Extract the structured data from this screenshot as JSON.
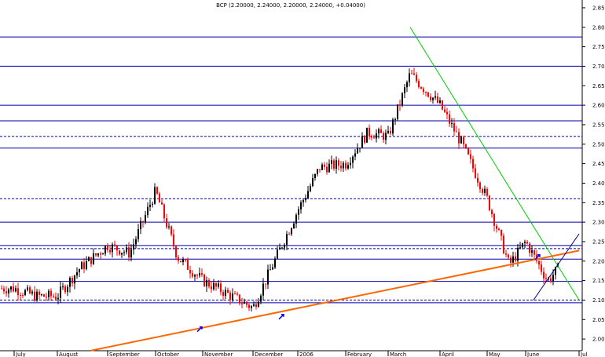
{
  "chart_data": {
    "type": "candlestick",
    "title": "BCP (2.20000, 2.24000, 2.20000, 2.24000, +0.04000)",
    "x_tick_labels": [
      "July",
      "August",
      "September",
      "October",
      "November",
      "December",
      "2006",
      "February",
      "March",
      "April",
      "May",
      "June",
      "Jul"
    ],
    "y_tick_labels": [
      "2.00",
      "2.05",
      "2.10",
      "2.15",
      "2.20",
      "2.25",
      "2.30",
      "2.35",
      "2.40",
      "2.45",
      "2.50",
      "2.55",
      "2.60",
      "2.65",
      "2.70",
      "2.75",
      "2.80",
      "2.85"
    ],
    "ylim": [
      1.97,
      2.87
    ],
    "ytick_step": 0.05,
    "grid": false,
    "colors": {
      "up_candle": "#000000",
      "down_candle": "#ff0000",
      "support_resistance": "#0000aa",
      "downtrend_line": "#00cc00",
      "uptrend_line": "#ff6600",
      "channel_line": "#000080",
      "arrow_marker": "#0000ff"
    },
    "horizontal_levels": [
      {
        "value": 2.775,
        "style": "solid"
      },
      {
        "value": 2.7,
        "style": "solid"
      },
      {
        "value": 2.6,
        "style": "solid"
      },
      {
        "value": 2.56,
        "style": "solid"
      },
      {
        "value": 2.52,
        "style": "dashed"
      },
      {
        "value": 2.49,
        "style": "solid"
      },
      {
        "value": 2.36,
        "style": "dashed"
      },
      {
        "value": 2.3,
        "style": "solid"
      },
      {
        "value": 2.24,
        "style": "solid"
      },
      {
        "value": 2.232,
        "style": "dashed"
      },
      {
        "value": 2.205,
        "style": "solid"
      },
      {
        "value": 2.148,
        "style": "solid"
      },
      {
        "value": 2.1,
        "style": "dashed"
      },
      {
        "value": 2.093,
        "style": "solid"
      }
    ],
    "trend_lines": [
      {
        "name": "downtrend",
        "from": [
          "March",
          2.8
        ],
        "to": [
          "Jul",
          2.1
        ]
      },
      {
        "name": "long-term uptrend",
        "from": [
          "September",
          1.97
        ],
        "to": [
          "Jul",
          2.227
        ]
      },
      {
        "name": "short channel",
        "from": [
          "June",
          2.1
        ],
        "to": [
          "Jul",
          2.27
        ]
      }
    ],
    "series_points": [
      {
        "x": "July",
        "close": 2.13
      },
      {
        "x": "July",
        "close": 2.11
      },
      {
        "x": "August",
        "close": 2.11
      },
      {
        "x": "August",
        "close": 2.18
      },
      {
        "x": "September",
        "close": 2.24
      },
      {
        "x": "September",
        "close": 2.22
      },
      {
        "x": "October",
        "close": 2.38
      },
      {
        "x": "October",
        "close": 2.21
      },
      {
        "x": "November",
        "close": 2.15
      },
      {
        "x": "November",
        "close": 2.12
      },
      {
        "x": "December",
        "close": 2.08
      },
      {
        "x": "2006",
        "close": 2.33
      },
      {
        "x": "2006",
        "close": 2.44
      },
      {
        "x": "February",
        "close": 2.45
      },
      {
        "x": "February",
        "close": 2.53
      },
      {
        "x": "March",
        "close": 2.52
      },
      {
        "x": "March",
        "close": 2.68
      },
      {
        "x": "April",
        "close": 2.6
      },
      {
        "x": "April",
        "close": 2.5
      },
      {
        "x": "May",
        "close": 2.36
      },
      {
        "x": "May",
        "close": 2.19
      },
      {
        "x": "June",
        "close": 2.25
      },
      {
        "x": "June",
        "close": 2.15
      },
      {
        "x": "Jul",
        "close": 2.24
      }
    ]
  }
}
